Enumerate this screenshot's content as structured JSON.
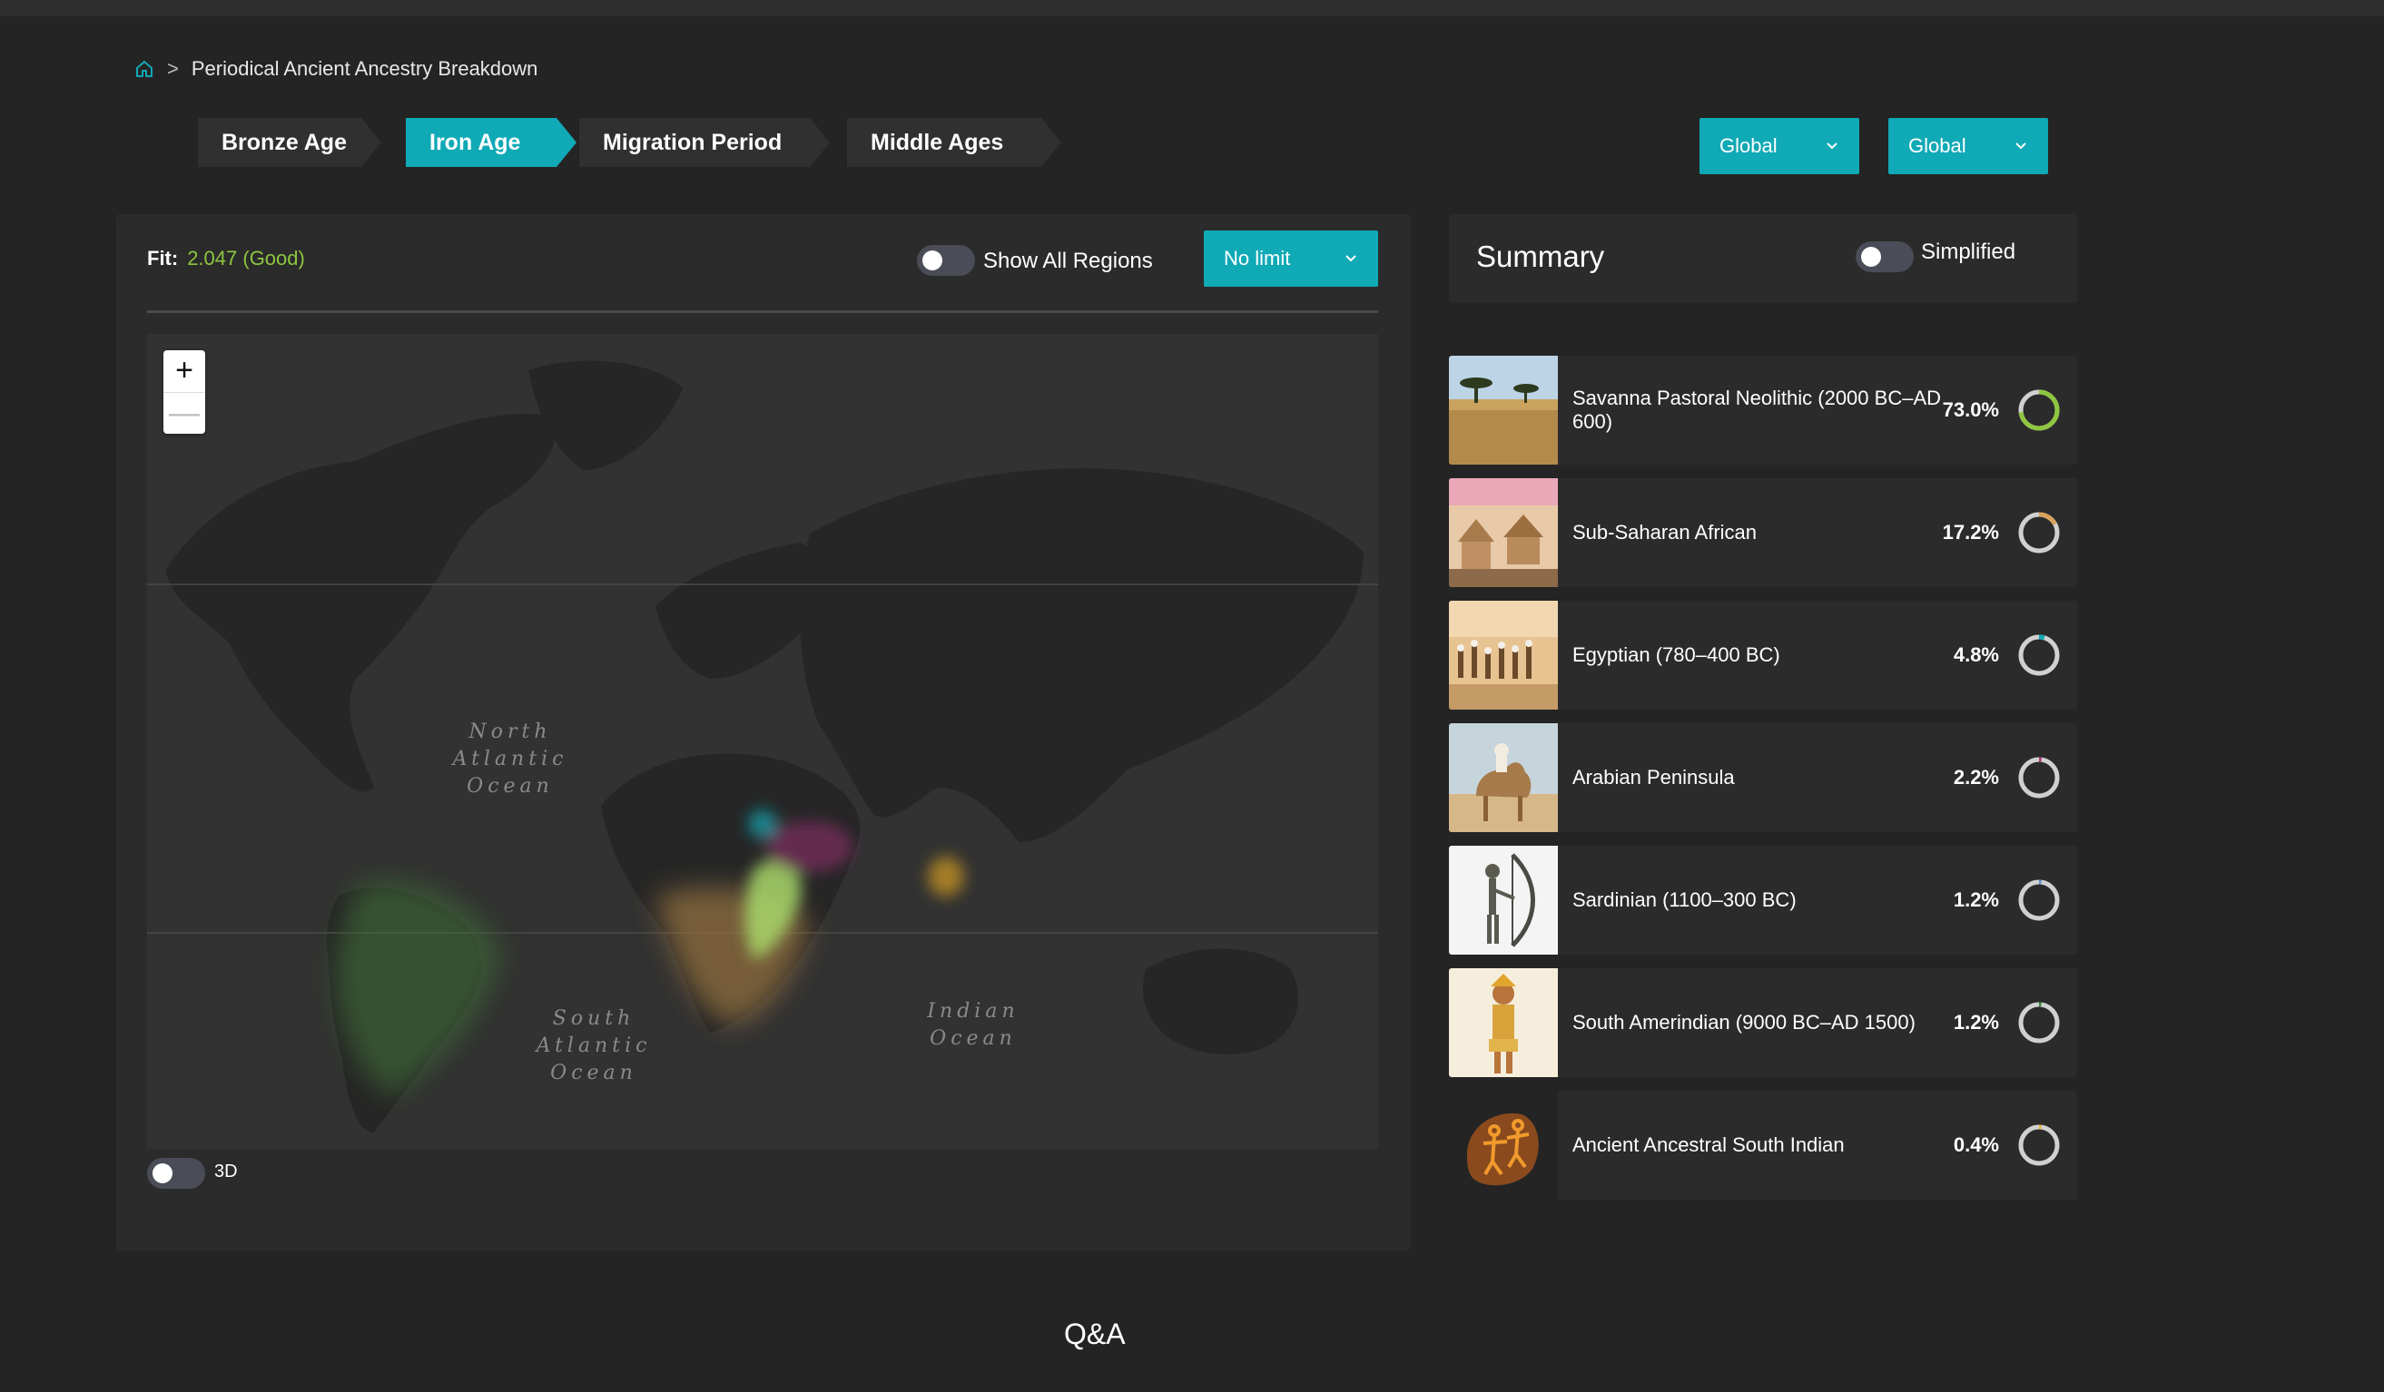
{
  "breadcrumb": {
    "home_icon": "home-icon",
    "separator": ">",
    "current": "Periodical Ancient Ancestry Breakdown"
  },
  "tabs": [
    {
      "label": "Bronze Age",
      "active": false
    },
    {
      "label": "Iron Age",
      "active": true
    },
    {
      "label": "Migration Period",
      "active": false
    },
    {
      "label": "Middle Ages",
      "active": false
    }
  ],
  "region_selects": [
    {
      "value": "Global"
    },
    {
      "value": "Global"
    }
  ],
  "map_panel": {
    "fit_label": "Fit:",
    "fit_value": "2.047 (Good)",
    "show_all_regions_label": "Show All Regions",
    "limit_select": "No limit",
    "zoom_in": "+",
    "zoom_out": "—",
    "three_d_label": "3D",
    "ocean_labels": {
      "north_atlantic": "North\nAtlantic\nOcean",
      "south_atlantic": "South\nAtlantic\nOcean",
      "indian": "Indian\nOcean"
    }
  },
  "summary": {
    "title": "Summary",
    "simplified_label": "Simplified",
    "items": [
      {
        "name": "Savanna Pastoral Neolithic (2000 BC–AD 600)",
        "percent": "73.0%",
        "value": 73.0,
        "color": "#8ec63f"
      },
      {
        "name": "Sub-Saharan African",
        "percent": "17.2%",
        "value": 17.2,
        "color": "#d9a35b"
      },
      {
        "name": "Egyptian (780–400 BC)",
        "percent": "4.8%",
        "value": 4.8,
        "color": "#10a9b6"
      },
      {
        "name": "Arabian Peninsula",
        "percent": "2.2%",
        "value": 2.2,
        "color": "#b3397e"
      },
      {
        "name": "Sardinian (1100–300 BC)",
        "percent": "1.2%",
        "value": 1.2,
        "color": "#5a8fc8"
      },
      {
        "name": "South Amerindian (9000 BC–AD 1500)",
        "percent": "1.2%",
        "value": 1.2,
        "color": "#3f8a3a"
      },
      {
        "name": "Ancient Ancestral South Indian",
        "percent": "0.4%",
        "value": 0.4,
        "color": "#e8b83a"
      }
    ]
  },
  "footer": {
    "qa_title": "Q&A"
  }
}
